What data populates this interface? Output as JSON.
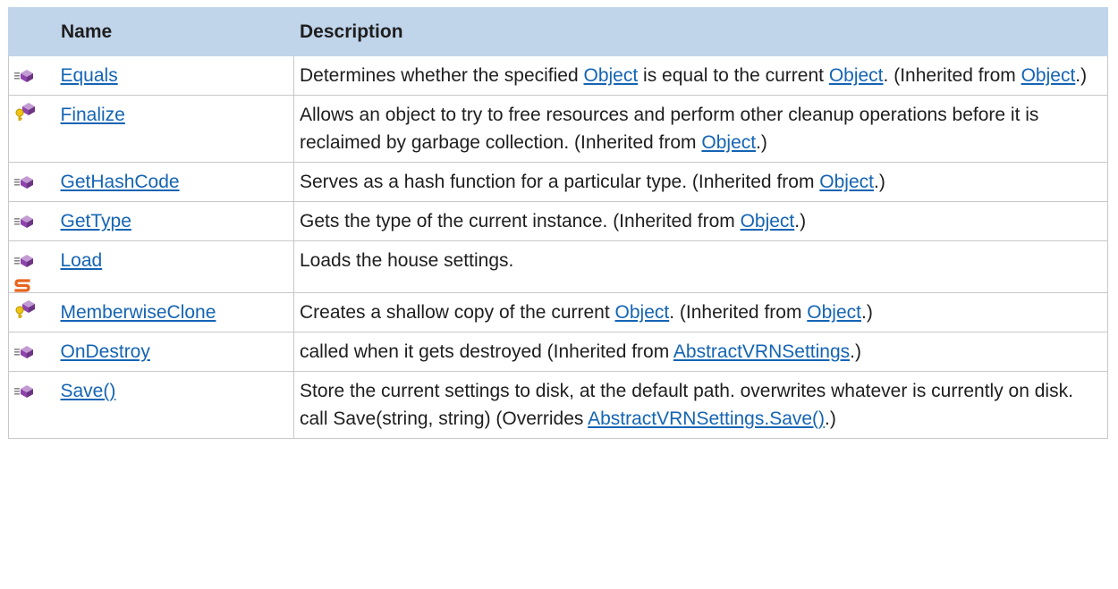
{
  "header": {
    "name_label": "Name",
    "description_label": "Description"
  },
  "rows": [
    {
      "icon": "public-method-icon",
      "name": "Equals",
      "desc": [
        {
          "t": "Determines whether the specified "
        },
        {
          "link": "Object"
        },
        {
          "t": " is equal to the current "
        },
        {
          "link": "Object"
        },
        {
          "t": ". (Inherited from "
        },
        {
          "link": "Object"
        },
        {
          "t": ".)"
        }
      ]
    },
    {
      "icon": "protected-method-icon",
      "name": "Finalize",
      "desc": [
        {
          "t": "Allows an object to try to free resources and perform other cleanup operations before it is reclaimed by garbage collection. (Inherited from "
        },
        {
          "link": "Object"
        },
        {
          "t": ".)"
        }
      ]
    },
    {
      "icon": "public-method-icon",
      "name": "GetHashCode",
      "desc": [
        {
          "t": "Serves as a hash function for a particular type. (Inherited from "
        },
        {
          "link": "Object"
        },
        {
          "t": ".)"
        }
      ]
    },
    {
      "icon": "public-method-icon",
      "name": "GetType",
      "desc": [
        {
          "t": "Gets the type of the current instance. (Inherited from "
        },
        {
          "link": "Object"
        },
        {
          "t": ".)"
        }
      ]
    },
    {
      "icon": "public-method-icon",
      "static": true,
      "name": "Load",
      "desc": [
        {
          "t": "Loads the house settings."
        }
      ]
    },
    {
      "icon": "protected-method-icon",
      "name": "MemberwiseClone",
      "desc": [
        {
          "t": "Creates a shallow copy of the current "
        },
        {
          "link": "Object"
        },
        {
          "t": ". (Inherited from "
        },
        {
          "link": "Object"
        },
        {
          "t": ".)"
        }
      ]
    },
    {
      "icon": "public-method-icon",
      "name": "OnDestroy",
      "desc": [
        {
          "t": "called when it gets destroyed (Inherited from "
        },
        {
          "link": "AbstractVRNSettings"
        },
        {
          "t": ".)"
        }
      ]
    },
    {
      "icon": "public-method-icon",
      "name": "Save()",
      "desc": [
        {
          "t": "Store the current settings to disk, at the default path. overwrites whatever is currently on disk. call Save(string, string) (Overrides "
        },
        {
          "link": "AbstractVRNSettings.Save()"
        },
        {
          "t": ".)"
        }
      ]
    }
  ],
  "colors": {
    "header_bg": "#c0d4ea",
    "link": "#1464b4",
    "border": "#c8c8c8",
    "method_purple": "#9b59b6",
    "static_orange": "#e8641e"
  }
}
